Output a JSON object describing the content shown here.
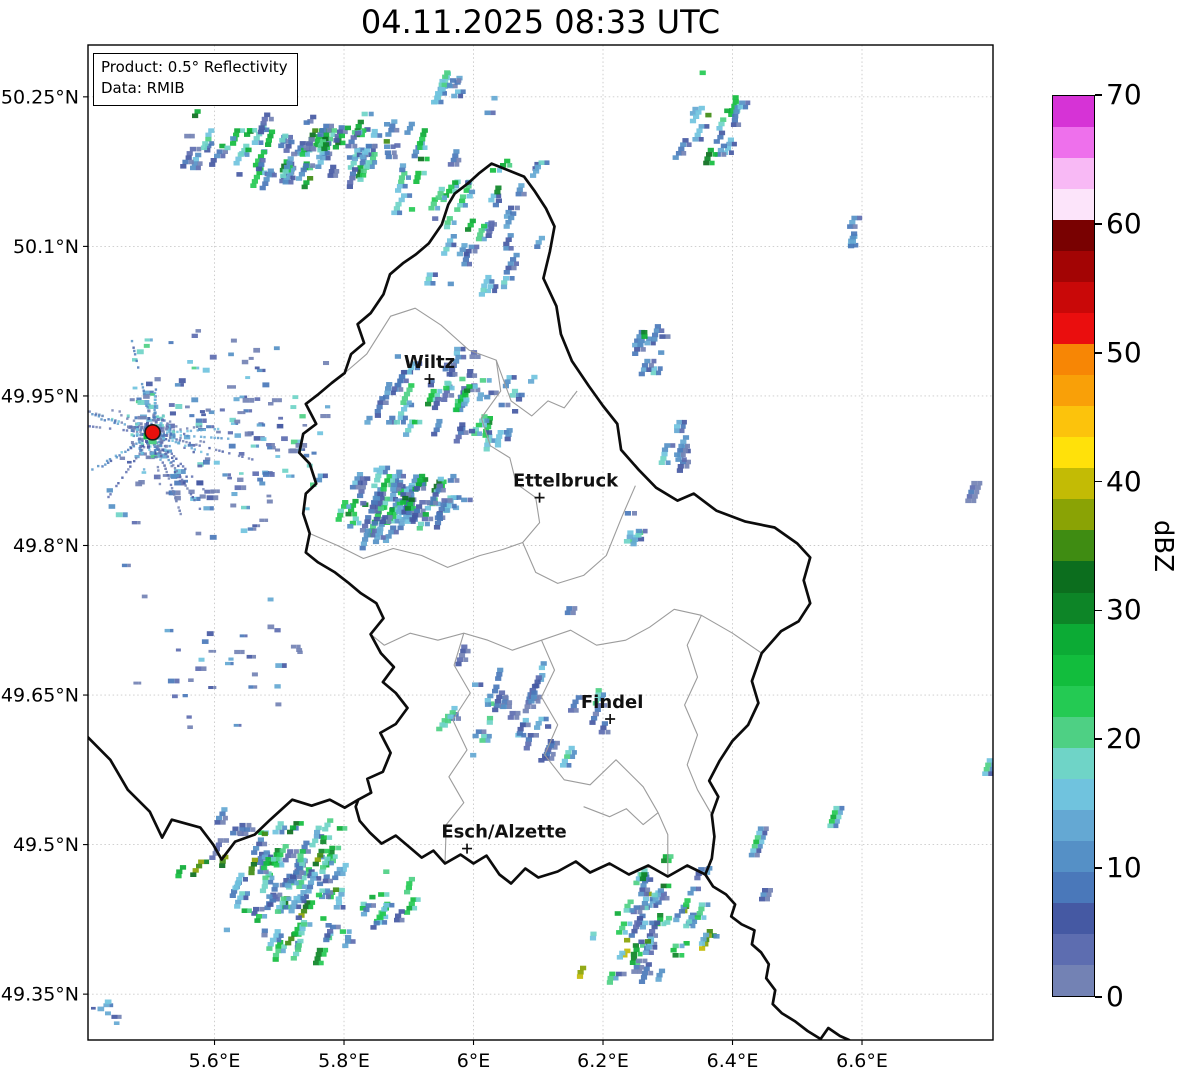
{
  "title": "04.11.2025 08:33 UTC",
  "product_box": {
    "line1": "Product: 0.5° Reflectivity",
    "line2": "Data: RMIB"
  },
  "colorbar": {
    "label": "dBZ",
    "vmin": 0,
    "vmax": 70,
    "step": 2.5,
    "ticks": [
      0,
      10,
      20,
      30,
      40,
      50,
      60,
      70
    ],
    "colors": [
      "#7382b4",
      "#5d6db0",
      "#4559a3",
      "#4a78ba",
      "#5590c6",
      "#64a8d3",
      "#70c3de",
      "#6fd4c7",
      "#4ed084",
      "#24ca53",
      "#12bd3d",
      "#0cab35",
      "#0d8527",
      "#0c6e1e",
      "#3f8c12",
      "#8aa305",
      "#c3bb05",
      "#ffe10a",
      "#fcc30c",
      "#f9a008",
      "#f78605",
      "#ea0e0e",
      "#c90808",
      "#a30404",
      "#790101",
      "#fce4fa",
      "#f8b9f5",
      "#ee70ec"
    ],
    "top_color": "#d633d6"
  },
  "axes": {
    "lon_min": 5.4046,
    "lon_max": 6.8023,
    "lat_min": 49.304,
    "lat_max": 50.302,
    "xticks": [
      {
        "v": 5.6,
        "label": "5.6°E"
      },
      {
        "v": 5.8,
        "label": "5.8°E"
      },
      {
        "v": 6.0,
        "label": "6°E"
      },
      {
        "v": 6.2,
        "label": "6.2°E"
      },
      {
        "v": 6.4,
        "label": "6.4°E"
      },
      {
        "v": 6.6,
        "label": "6.6°E"
      }
    ],
    "yticks": [
      {
        "v": 50.25,
        "label": "50.25°N"
      },
      {
        "v": 50.1,
        "label": "50.1°N"
      },
      {
        "v": 49.95,
        "label": "49.95°N"
      },
      {
        "v": 49.8,
        "label": "49.8°N"
      },
      {
        "v": 49.65,
        "label": "49.65°N"
      },
      {
        "v": 49.5,
        "label": "49.5°N"
      },
      {
        "v": 49.35,
        "label": "49.35°N"
      }
    ]
  },
  "cities": [
    {
      "name": "Wiltz",
      "lon": 5.932,
      "lat": 49.967,
      "label_dx": 0,
      "label_dy": -11
    },
    {
      "name": "Ettelbruck",
      "lon": 6.102,
      "lat": 49.848,
      "label_dx": 26,
      "label_dy": -11
    },
    {
      "name": "Findel",
      "lon": 6.211,
      "lat": 49.626,
      "label_dx": 2,
      "label_dy": -11
    },
    {
      "name": "Esch/Alzette",
      "lon": 5.99,
      "lat": 49.496,
      "label_dx": 37,
      "label_dy": -11
    }
  ],
  "radar_site": {
    "lon": 5.5044,
    "lat": 49.9135,
    "color": "#e8100c",
    "seed": 9
  },
  "borders": {
    "country": [
      [
        6.028,
        50.183
      ],
      [
        6.078,
        50.17
      ],
      [
        6.095,
        50.155
      ],
      [
        6.112,
        50.138
      ],
      [
        6.125,
        50.12
      ],
      [
        6.118,
        50.095
      ],
      [
        6.108,
        50.068
      ],
      [
        6.128,
        50.04
      ],
      [
        6.135,
        50.012
      ],
      [
        6.152,
        49.985
      ],
      [
        6.178,
        49.96
      ],
      [
        6.2,
        49.94
      ],
      [
        6.222,
        49.922
      ],
      [
        6.228,
        49.896
      ],
      [
        6.255,
        49.876
      ],
      [
        6.282,
        49.858
      ],
      [
        6.315,
        49.845
      ],
      [
        6.34,
        49.852
      ],
      [
        6.375,
        49.835
      ],
      [
        6.42,
        49.824
      ],
      [
        6.465,
        49.818
      ],
      [
        6.5,
        49.802
      ],
      [
        6.52,
        49.788
      ],
      [
        6.51,
        49.765
      ],
      [
        6.52,
        49.742
      ],
      [
        6.502,
        49.724
      ],
      [
        6.475,
        49.714
      ],
      [
        6.445,
        49.692
      ],
      [
        6.43,
        49.664
      ],
      [
        6.44,
        49.642
      ],
      [
        6.424,
        49.62
      ],
      [
        6.4,
        49.604
      ],
      [
        6.38,
        49.584
      ],
      [
        6.364,
        49.564
      ],
      [
        6.378,
        49.548
      ],
      [
        6.368,
        49.53
      ],
      [
        6.372,
        49.508
      ],
      [
        6.368,
        49.486
      ],
      [
        6.358,
        49.47
      ],
      [
        6.33,
        49.479
      ],
      [
        6.3,
        49.468
      ],
      [
        6.27,
        49.479
      ],
      [
        6.24,
        49.47
      ],
      [
        6.21,
        49.481
      ],
      [
        6.18,
        49.472
      ],
      [
        6.158,
        49.483
      ],
      [
        6.13,
        49.473
      ],
      [
        6.1,
        49.467
      ],
      [
        6.08,
        49.476
      ],
      [
        6.058,
        49.461
      ],
      [
        6.04,
        49.47
      ],
      [
        6.02,
        49.489
      ],
      [
        6.0,
        49.481
      ],
      [
        5.98,
        49.49
      ],
      [
        5.956,
        49.481
      ],
      [
        5.938,
        49.494
      ],
      [
        5.92,
        49.487
      ],
      [
        5.9,
        49.498
      ],
      [
        5.88,
        49.509
      ],
      [
        5.858,
        49.501
      ],
      [
        5.84,
        49.512
      ],
      [
        5.824,
        49.524
      ],
      [
        5.818,
        49.538
      ],
      [
        5.822,
        49.545
      ],
      [
        5.842,
        49.552
      ],
      [
        5.836,
        49.566
      ],
      [
        5.86,
        49.573
      ],
      [
        5.872,
        49.592
      ],
      [
        5.856,
        49.612
      ],
      [
        5.88,
        49.621
      ],
      [
        5.898,
        49.637
      ],
      [
        5.88,
        49.652
      ],
      [
        5.86,
        49.663
      ],
      [
        5.877,
        49.678
      ],
      [
        5.857,
        49.692
      ],
      [
        5.841,
        49.711
      ],
      [
        5.861,
        49.727
      ],
      [
        5.85,
        49.742
      ],
      [
        5.826,
        49.752
      ],
      [
        5.806,
        49.763
      ],
      [
        5.786,
        49.773
      ],
      [
        5.76,
        49.783
      ],
      [
        5.741,
        49.793
      ],
      [
        5.747,
        49.812
      ],
      [
        5.737,
        49.832
      ],
      [
        5.741,
        49.852
      ],
      [
        5.757,
        49.862
      ],
      [
        5.747,
        49.882
      ],
      [
        5.731,
        49.893
      ],
      [
        5.737,
        49.912
      ],
      [
        5.757,
        49.922
      ],
      [
        5.741,
        49.942
      ],
      [
        5.761,
        49.952
      ],
      [
        5.781,
        49.963
      ],
      [
        5.801,
        49.973
      ],
      [
        5.811,
        49.992
      ],
      [
        5.831,
        50.003
      ],
      [
        5.821,
        50.022
      ],
      [
        5.841,
        50.033
      ],
      [
        5.861,
        50.052
      ],
      [
        5.871,
        50.072
      ],
      [
        5.891,
        50.083
      ],
      [
        5.911,
        50.092
      ],
      [
        5.931,
        50.103
      ],
      [
        5.951,
        50.122
      ],
      [
        5.961,
        50.142
      ],
      [
        5.971,
        50.153
      ],
      [
        5.991,
        50.163
      ],
      [
        6.008,
        50.173
      ]
    ],
    "west_line": [
      [
        5.404,
        49.608
      ],
      [
        5.439,
        49.585
      ],
      [
        5.466,
        49.555
      ],
      [
        5.5,
        49.533
      ],
      [
        5.519,
        49.507
      ],
      [
        5.534,
        49.525
      ],
      [
        5.578,
        49.517
      ],
      [
        5.598,
        49.5
      ],
      [
        5.611,
        49.485
      ],
      [
        5.632,
        49.503
      ],
      [
        5.662,
        49.51
      ],
      [
        5.686,
        49.525
      ],
      [
        5.72,
        49.545
      ],
      [
        5.75,
        49.539
      ],
      [
        5.778,
        49.545
      ],
      [
        5.801,
        49.537
      ],
      [
        5.822,
        49.545
      ]
    ],
    "southeast_line": [
      [
        6.358,
        49.47
      ],
      [
        6.37,
        49.458
      ],
      [
        6.39,
        49.45
      ],
      [
        6.404,
        49.44
      ],
      [
        6.398,
        49.428
      ],
      [
        6.414,
        49.42
      ],
      [
        6.434,
        49.414
      ],
      [
        6.43,
        49.4
      ],
      [
        6.444,
        49.392
      ],
      [
        6.456,
        49.38
      ],
      [
        6.452,
        49.366
      ],
      [
        6.466,
        49.354
      ],
      [
        6.462,
        49.34
      ],
      [
        6.476,
        49.331
      ],
      [
        6.496,
        49.323
      ],
      [
        6.516,
        49.313
      ],
      [
        6.536,
        49.305
      ],
      [
        6.548,
        49.316
      ],
      [
        6.566,
        49.308
      ],
      [
        6.58,
        49.304
      ]
    ],
    "internal": [
      [
        [
          5.801,
          49.973
        ],
        [
          5.835,
          49.992
        ],
        [
          5.872,
          50.03
        ],
        [
          5.91,
          50.038
        ],
        [
          5.95,
          50.021
        ],
        [
          5.993,
          49.996
        ],
        [
          6.035,
          49.986
        ],
        [
          6.058,
          49.945
        ],
        [
          6.09,
          49.93
        ],
        [
          6.115,
          49.945
        ],
        [
          6.14,
          49.938
        ],
        [
          6.16,
          49.955
        ]
      ],
      [
        [
          6.035,
          49.986
        ],
        [
          6.042,
          49.955
        ],
        [
          6.012,
          49.928
        ],
        [
          6.026,
          49.9
        ],
        [
          6.056,
          49.888
        ],
        [
          6.066,
          49.862
        ],
        [
          6.096,
          49.848
        ],
        [
          6.102,
          49.823
        ],
        [
          6.076,
          49.803
        ],
        [
          6.096,
          49.773
        ],
        [
          6.13,
          49.762
        ],
        [
          6.17,
          49.77
        ],
        [
          6.205,
          49.79
        ],
        [
          6.23,
          49.83
        ],
        [
          6.25,
          49.86
        ]
      ],
      [
        [
          5.747,
          49.812
        ],
        [
          5.79,
          49.8
        ],
        [
          5.83,
          49.787
        ],
        [
          5.876,
          49.797
        ],
        [
          5.92,
          49.79
        ],
        [
          5.96,
          49.778
        ],
        [
          6.01,
          49.79
        ],
        [
          6.045,
          49.796
        ],
        [
          6.076,
          49.803
        ]
      ],
      [
        [
          5.841,
          49.711
        ],
        [
          5.862,
          49.7
        ],
        [
          5.902,
          49.712
        ],
        [
          5.945,
          49.705
        ],
        [
          5.985,
          49.712
        ],
        [
          6.022,
          49.705
        ],
        [
          6.06,
          49.695
        ],
        [
          6.105,
          49.705
        ],
        [
          6.15,
          49.715
        ],
        [
          6.19,
          49.7
        ],
        [
          6.235,
          49.705
        ],
        [
          6.272,
          49.718
        ],
        [
          6.31,
          49.736
        ],
        [
          6.352,
          49.73
        ],
        [
          6.4,
          49.712
        ],
        [
          6.445,
          49.692
        ]
      ],
      [
        [
          6.105,
          49.705
        ],
        [
          6.125,
          49.675
        ],
        [
          6.105,
          49.648
        ],
        [
          6.13,
          49.62
        ],
        [
          6.11,
          49.59
        ],
        [
          6.14,
          49.565
        ],
        [
          6.18,
          49.56
        ],
        [
          6.22,
          49.585
        ],
        [
          6.262,
          49.558
        ],
        [
          6.285,
          49.532
        ],
        [
          6.3,
          49.51
        ],
        [
          6.3,
          49.468
        ]
      ],
      [
        [
          5.985,
          49.712
        ],
        [
          5.97,
          49.68
        ],
        [
          5.995,
          49.652
        ],
        [
          5.968,
          49.625
        ],
        [
          5.99,
          49.595
        ],
        [
          5.962,
          49.568
        ],
        [
          5.985,
          49.542
        ],
        [
          5.958,
          49.52
        ],
        [
          5.956,
          49.481
        ]
      ],
      [
        [
          6.352,
          49.73
        ],
        [
          6.33,
          49.7
        ],
        [
          6.346,
          49.668
        ],
        [
          6.326,
          49.64
        ],
        [
          6.346,
          49.61
        ],
        [
          6.33,
          49.58
        ],
        [
          6.346,
          49.555
        ],
        [
          6.368,
          49.53
        ]
      ],
      [
        [
          6.17,
          49.538
        ],
        [
          6.21,
          49.528
        ],
        [
          6.236,
          49.536
        ],
        [
          6.262,
          49.52
        ],
        [
          6.285,
          49.532
        ]
      ]
    ]
  },
  "chart_data": {
    "type": "heatmap",
    "field": "radar_reflectivity",
    "units": "dBZ",
    "value_range_dbz": [
      0,
      70
    ],
    "legend_position": "right",
    "grid": true,
    "clusters": [
      {
        "name": "northwest-band",
        "lon": 5.7475,
        "lat": 50.2047,
        "dlon": 0.2,
        "dlat": 0.04,
        "n": 90,
        "dbz": [
          5,
          33
        ],
        "seed": 11,
        "type": "streaks"
      },
      {
        "name": "north-center-scatter",
        "lon": 6.01,
        "lat": 50.1616,
        "dlon": 0.13,
        "dlat": 0.105,
        "n": 42,
        "dbz": [
          5,
          30
        ],
        "seed": 22,
        "type": "streaks"
      },
      {
        "name": "topright-streaks",
        "lon": 6.373,
        "lat": 50.2318,
        "dlon": 0.065,
        "dlat": 0.062,
        "n": 15,
        "dbz": [
          8,
          33
        ],
        "seed": 33,
        "type": "streaks"
      },
      {
        "name": "topright-single",
        "lon": 6.583,
        "lat": 50.1144,
        "dlon": 0.012,
        "dlat": 0.02,
        "n": 4,
        "dbz": [
          8,
          22
        ],
        "seed": 44,
        "type": "streaks"
      },
      {
        "name": "east-mid",
        "lon": 6.2757,
        "lat": 49.9981,
        "dlon": 0.035,
        "dlat": 0.03,
        "n": 9,
        "dbz": [
          8,
          30
        ],
        "seed": 55,
        "type": "streaks"
      },
      {
        "name": "east-mid-2",
        "lon": 6.3096,
        "lat": 49.9038,
        "dlon": 0.018,
        "dlat": 0.028,
        "n": 5,
        "dbz": [
          8,
          26
        ],
        "seed": 66,
        "type": "streaks"
      },
      {
        "name": "wiltz-scatter",
        "lon": 5.9637,
        "lat": 49.9559,
        "dlon": 0.145,
        "dlat": 0.055,
        "n": 50,
        "dbz": [
          5,
          29
        ],
        "seed": 88,
        "type": "streaks"
      },
      {
        "name": "clutter-field-west",
        "lon": 5.6007,
        "lat": 49.9158,
        "dlon": 0.185,
        "dlat": 0.125,
        "n": 175,
        "dbz": [
          0,
          22
        ],
        "seed": 111,
        "type": "speckle"
      },
      {
        "name": "band-west-ettelbruck",
        "lon": 5.871,
        "lat": 49.8487,
        "dlon": 0.115,
        "dlat": 0.038,
        "n": 70,
        "dbz": [
          5,
          33
        ],
        "seed": 122,
        "type": "streaks"
      },
      {
        "name": "south-radar-sparse",
        "lon": 5.6007,
        "lat": 49.6902,
        "dlon": 0.165,
        "dlat": 0.095,
        "n": 34,
        "dbz": [
          0,
          16
        ],
        "seed": 133,
        "type": "speckle"
      },
      {
        "name": "center-sparse",
        "lon": 6.0718,
        "lat": 49.6451,
        "dlon": 0.145,
        "dlat": 0.08,
        "n": 36,
        "dbz": [
          5,
          22
        ],
        "seed": 144,
        "type": "streaks"
      },
      {
        "name": "bottomleft-cluster",
        "lon": 5.7321,
        "lat": 49.4665,
        "dlon": 0.2,
        "dlat": 0.075,
        "n": 100,
        "dbz": [
          5,
          38
        ],
        "seed": 155,
        "type": "streaks"
      },
      {
        "name": "south-esch-cluster",
        "lon": 6.2726,
        "lat": 49.4294,
        "dlon": 0.115,
        "dlat": 0.068,
        "n": 55,
        "dbz": [
          5,
          41
        ],
        "seed": 166,
        "type": "streaks"
      },
      {
        "name": "corner-bottomleft",
        "lon": 5.4355,
        "lat": 49.3362,
        "dlon": 0.03,
        "dlat": 0.018,
        "n": 7,
        "dbz": [
          5,
          18
        ],
        "seed": 177,
        "type": "speckle"
      },
      {
        "name": "top-edge-bits",
        "lon": 5.956,
        "lat": 50.2719,
        "dlon": 0.028,
        "dlat": 0.022,
        "n": 8,
        "dbz": [
          8,
          26
        ],
        "seed": 188,
        "type": "streaks"
      },
      {
        "name": "ettelbruck-east",
        "lon": 6.2417,
        "lat": 49.8176,
        "dlon": 0.022,
        "dlat": 0.022,
        "n": 5,
        "dbz": [
          8,
          22
        ],
        "seed": 199,
        "type": "streaks"
      }
    ],
    "singles": [
      {
        "lon": 6.431,
        "lat": 49.505,
        "dbz": 27,
        "len": 7
      },
      {
        "lon": 6.55,
        "lat": 49.53,
        "dbz": 29,
        "len": 5
      },
      {
        "lon": 6.788,
        "lat": 49.58,
        "dbz": 24,
        "len": 4
      },
      {
        "lon": 6.442,
        "lat": 49.452,
        "dbz": 10,
        "len": 3
      },
      {
        "lon": 6.141,
        "lat": 49.737,
        "dbz": 10,
        "len": 2
      },
      {
        "lon": 6.763,
        "lat": 49.856,
        "dbz": 9,
        "len": 5
      }
    ]
  }
}
